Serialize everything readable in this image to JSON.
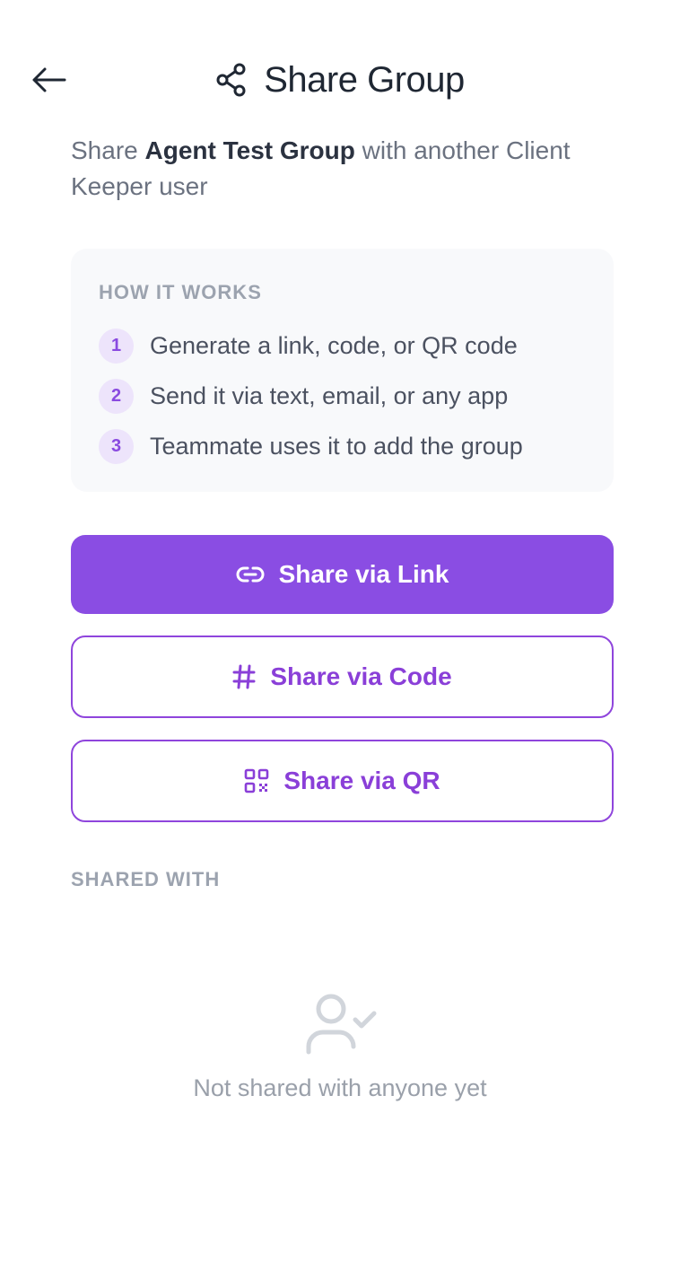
{
  "header": {
    "title": "Share Group",
    "back_icon": "arrow-left-icon",
    "title_icon": "share-icon"
  },
  "description": {
    "prefix": "Share ",
    "group_name": "Agent Test Group",
    "suffix": " with another Client Keeper user"
  },
  "how_it_works": {
    "heading": "HOW IT WORKS",
    "steps": [
      {
        "number": "1",
        "text": "Generate a link, code, or QR code"
      },
      {
        "number": "2",
        "text": "Send it via text, email, or any app"
      },
      {
        "number": "3",
        "text": "Teammate uses it to add the group"
      }
    ]
  },
  "actions": {
    "link": {
      "label": "Share via Link",
      "icon": "link-icon"
    },
    "code": {
      "label": "Share via Code",
      "icon": "hash-icon"
    },
    "qr": {
      "label": "Share via QR",
      "icon": "qr-code-icon"
    }
  },
  "shared_with": {
    "heading": "SHARED WITH",
    "empty_text": "Not shared with anyone yet",
    "empty_icon": "user-check-icon"
  },
  "colors": {
    "accent": "#8a4de3",
    "accent_text": "#8a3fd8",
    "muted": "#9ca3af",
    "card_bg": "#f8f9fb"
  }
}
